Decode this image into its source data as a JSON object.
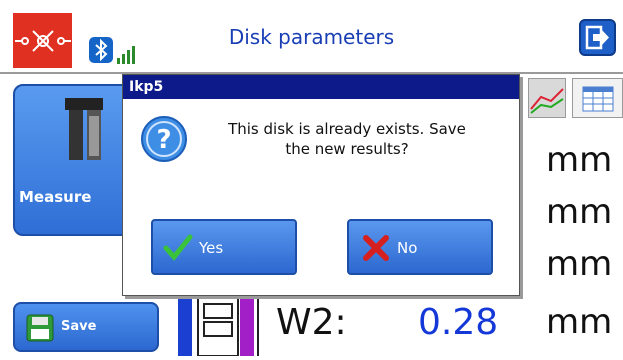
{
  "header": {
    "title": "Disk parameters"
  },
  "left_panel": {
    "measure_label": "Measure",
    "save_label": "Save"
  },
  "measurements": {
    "units": [
      "mm",
      "mm",
      "mm",
      "mm"
    ],
    "w2_label": "W2:",
    "w2_value": "0.28"
  },
  "dialog": {
    "title": "Ikp5",
    "message_line1": "This disk is already exists. Save",
    "message_line2": "the new results?",
    "yes_label": "Yes",
    "no_label": "No"
  },
  "colors": {
    "accent": "#1f5fc8",
    "title_bar": "#0c1a8a",
    "value_blue": "#1438d8",
    "logo_red": "#e03021"
  }
}
